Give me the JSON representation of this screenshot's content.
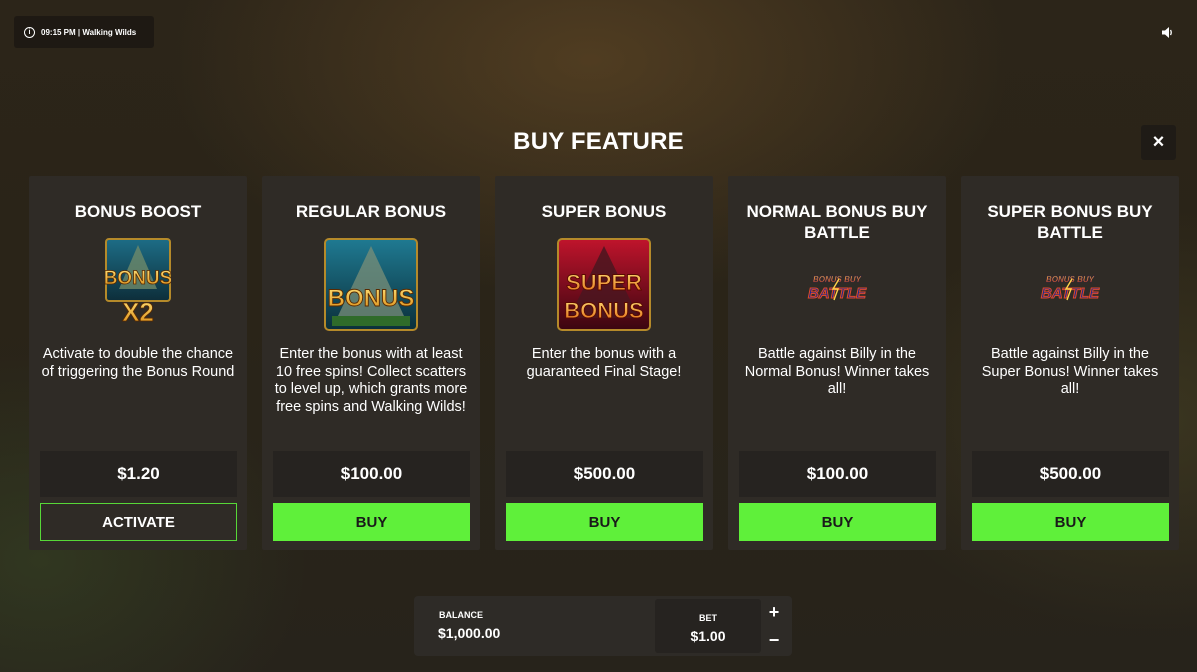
{
  "header": {
    "info_text": "09:15 PM | Walking Wilds",
    "info_icon": "info-icon",
    "sound_icon": "speaker-icon"
  },
  "modal": {
    "title": "BUY FEATURE",
    "close_label": "×"
  },
  "cards": [
    {
      "title": "BONUS BOOST",
      "art_text": [
        "BONUS",
        "X2"
      ],
      "description": "Activate to double the chance of triggering the Bonus Round",
      "price": "$1.20",
      "button": "ACTIVATE"
    },
    {
      "title": "REGULAR BONUS",
      "art_text": [
        "BONUS"
      ],
      "description": "Enter the bonus with at least 10 free spins! Collect scatters to level up, which grants more free spins and Walking Wilds!",
      "price": "$100.00",
      "button": "BUY"
    },
    {
      "title": "SUPER BONUS",
      "art_text": [
        "SUPER",
        "BONUS"
      ],
      "description": "Enter the bonus with a guaranteed Final Stage!",
      "price": "$500.00",
      "button": "BUY"
    },
    {
      "title": "NORMAL BONUS BUY BATTLE",
      "art_text": [
        "BONUS BUY",
        "BATTLE"
      ],
      "description": "Battle against Billy in the Normal Bonus! Winner takes all!",
      "price": "$100.00",
      "button": "BUY"
    },
    {
      "title": "SUPER BONUS BUY BATTLE",
      "art_text": [
        "BONUS BUY",
        "BATTLE"
      ],
      "description": "Battle against Billy in the Super Bonus! Winner takes all!",
      "price": "$500.00",
      "button": "BUY"
    }
  ],
  "footer": {
    "balance_label": "BALANCE",
    "balance_value": "$1,000.00",
    "bet_label": "BET",
    "bet_value": "$1.00",
    "plus": "+",
    "minus": "−"
  },
  "colors": {
    "buy_green": "#5ff03a",
    "card_bg": "#2f2b26",
    "price_bg": "#262320"
  }
}
